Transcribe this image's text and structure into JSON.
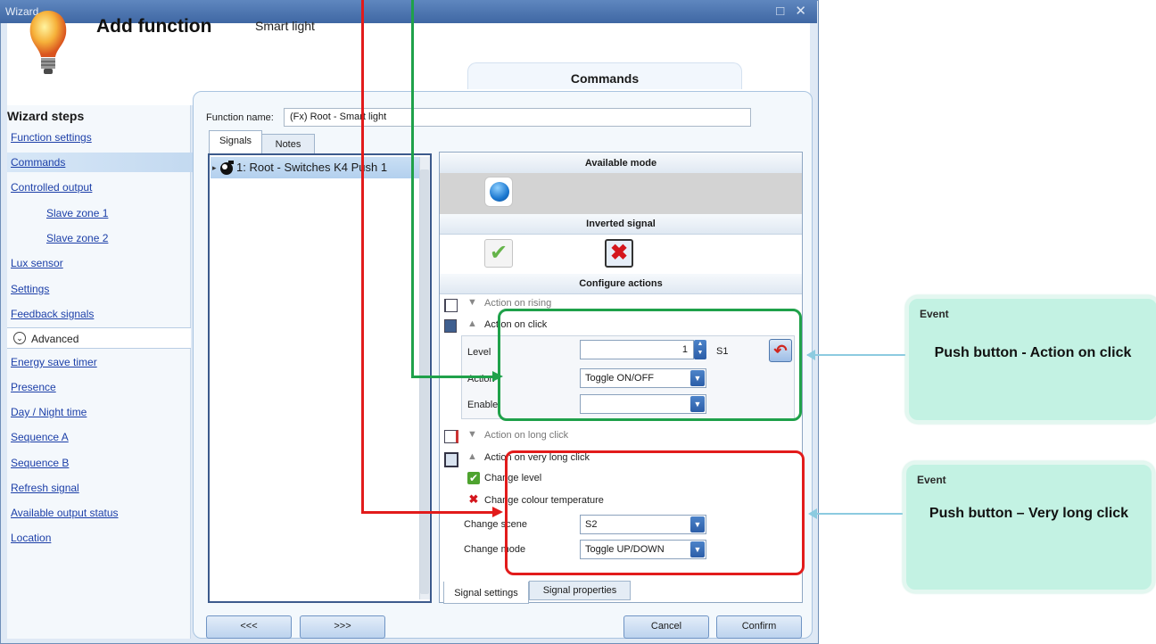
{
  "window": {
    "title": "Wizard...",
    "controls": "□ ✕"
  },
  "header": {
    "title": "Add function",
    "subtitle": "Smart light",
    "tab": "Commands"
  },
  "sidebar": {
    "title": "Wizard steps",
    "items": [
      {
        "label": "Function settings"
      },
      {
        "label": "Commands"
      },
      {
        "label": "Controlled output"
      },
      {
        "label": "Slave zone 1"
      },
      {
        "label": "Slave zone 2"
      },
      {
        "label": "Lux sensor"
      },
      {
        "label": "Settings"
      },
      {
        "label": "Feedback signals"
      }
    ],
    "advanced": "Advanced",
    "advanced_items": [
      {
        "label": "Energy save timer"
      },
      {
        "label": "Presence"
      },
      {
        "label": "Day / Night time"
      },
      {
        "label": "Sequence A"
      },
      {
        "label": "Sequence B"
      },
      {
        "label": "Refresh signal"
      },
      {
        "label": "Available output status"
      },
      {
        "label": "Location"
      }
    ]
  },
  "function_name": {
    "label": "Function name:",
    "value": "(Fx) Root - Smart light"
  },
  "tabs": {
    "signals": "Signals",
    "notes": "Notes"
  },
  "signal_list": {
    "item": "1: Root - Switches K4 Push 1"
  },
  "panel": {
    "available_mode": "Available mode",
    "inverted_signal": "Inverted signal",
    "configure_actions": "Configure actions",
    "action_rising": "Action on rising",
    "action_click": "Action on click",
    "level_label": "Level",
    "level_value": "1",
    "level_scene": "S1",
    "action_label": "Action",
    "action_value": "Toggle ON/OFF",
    "enable_label": "Enable",
    "enable_value": "",
    "action_long": "Action on long click",
    "action_very_long": "Action on very long click",
    "change_level": "Change level",
    "change_colour": "Change colour temperature",
    "change_scene_label": "Change scene",
    "change_scene_value": "S2",
    "change_mode_label": "Change mode",
    "change_mode_value": "Toggle UP/DOWN"
  },
  "bottom_tabs": {
    "settings": "Signal settings",
    "properties": "Signal properties"
  },
  "footer": {
    "prev": "<<<",
    "next": ">>>",
    "cancel": "Cancel",
    "confirm": "Confirm"
  },
  "callouts": [
    {
      "event": "Event",
      "text": "Push button - Action on click"
    },
    {
      "event": "Event",
      "text": "Push button – Very long click"
    }
  ],
  "colors": {
    "accent": "#3f67a3",
    "green_annotation": "#1fa14a",
    "red_annotation": "#e21b1b",
    "callout_bg": "#c3f2e3"
  }
}
